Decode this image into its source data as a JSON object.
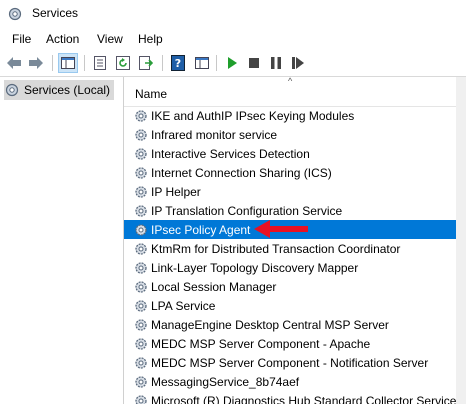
{
  "window": {
    "title": "Services",
    "icon": "services-gear-icon"
  },
  "menu": [
    "File",
    "Action",
    "View",
    "Help"
  ],
  "toolbar": {
    "buttons": [
      "back-arrow-icon",
      "forward-arrow-icon",
      "show-hide-tree-icon",
      "properties-icon",
      "refresh-icon",
      "export-list-icon",
      "help-icon",
      "play-icon",
      "stop-icon",
      "pause-icon",
      "restart-icon"
    ],
    "colors": {
      "play": "#1f9e2c",
      "stop": "#444444"
    }
  },
  "tree": {
    "label": "Services (Local)",
    "icon": "services-gear-icon"
  },
  "list": {
    "column_header": "Name",
    "selected_color": "#0078d7",
    "rows": [
      {
        "name": "IKE and AuthIP IPsec Keying Modules"
      },
      {
        "name": "Infrared monitor service"
      },
      {
        "name": "Interactive Services Detection"
      },
      {
        "name": "Internet Connection Sharing (ICS)"
      },
      {
        "name": "IP Helper"
      },
      {
        "name": "IP Translation Configuration Service"
      },
      {
        "name": "IPsec Policy Agent",
        "selected": true
      },
      {
        "name": "KtmRm for Distributed Transaction Coordinator"
      },
      {
        "name": "Link-Layer Topology Discovery Mapper"
      },
      {
        "name": "Local Session Manager"
      },
      {
        "name": "LPA Service"
      },
      {
        "name": "ManageEngine Desktop Central MSP Server"
      },
      {
        "name": "MEDC MSP Server Component - Apache"
      },
      {
        "name": "MEDC MSP Server Component - Notification Server"
      },
      {
        "name": "MessagingService_8b74aef"
      },
      {
        "name": "Microsoft (R) Diagnostics Hub Standard Collector Service"
      }
    ]
  },
  "annotation": {
    "arrow_color": "#e81123",
    "icon": "red-arrow-icon"
  }
}
